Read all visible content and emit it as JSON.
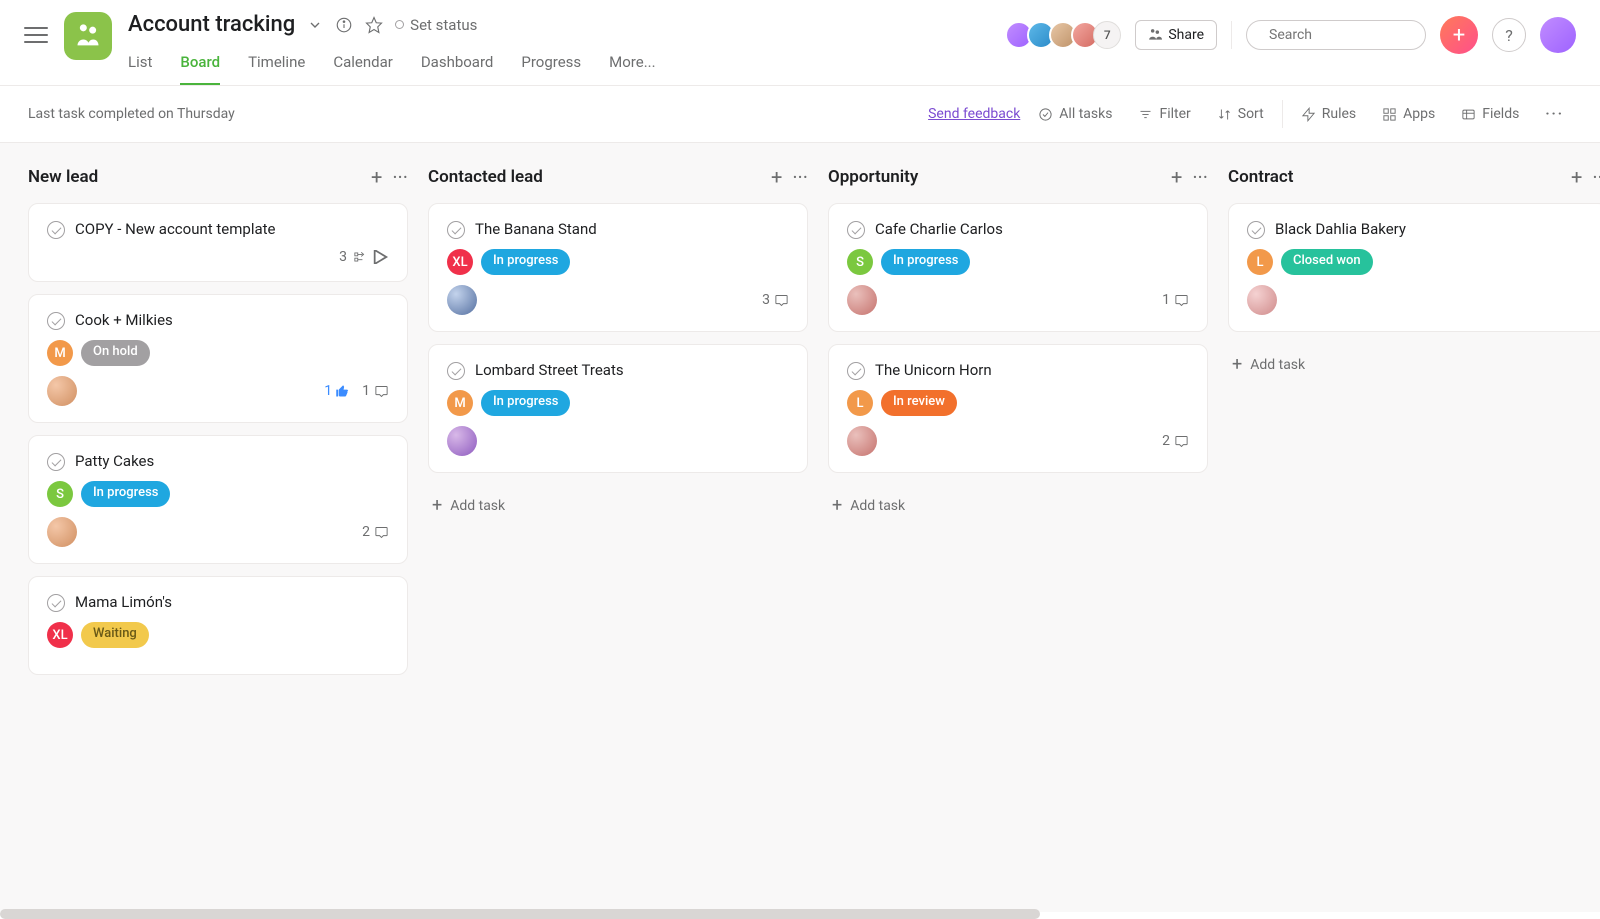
{
  "project": {
    "name": "Account tracking",
    "set_status": "Set status"
  },
  "tabs": {
    "list": "List",
    "board": "Board",
    "timeline": "Timeline",
    "calendar": "Calendar",
    "dashboard": "Dashboard",
    "progress": "Progress",
    "more": "More..."
  },
  "header": {
    "share": "Share",
    "search_placeholder": "Search",
    "help": "?",
    "overflow_count": "7"
  },
  "toolbar": {
    "last_task": "Last task completed on Thursday",
    "feedback": "Send feedback",
    "all_tasks": "All tasks",
    "filter": "Filter",
    "sort": "Sort",
    "rules": "Rules",
    "apps": "Apps",
    "fields": "Fields"
  },
  "add_task_label": "Add task",
  "columns": [
    {
      "title": "New lead",
      "cards": [
        {
          "title": "COPY - New account template",
          "pills": [],
          "assignee": null,
          "subtasks": "3",
          "likes": null,
          "comments": null
        },
        {
          "title": "Cook + Milkies",
          "pills": [
            {
              "text": "M",
              "short": true,
              "color": "c-orange"
            },
            {
              "text": "On hold",
              "color": "c-grey"
            }
          ],
          "assignee": "bg1",
          "likes": "1",
          "comments": "1"
        },
        {
          "title": "Patty Cakes",
          "pills": [
            {
              "text": "S",
              "short": true,
              "color": "c-green"
            },
            {
              "text": "In progress",
              "color": "c-blue"
            }
          ],
          "assignee": "bg1",
          "comments": "2"
        },
        {
          "title": "Mama Limón's",
          "pills": [
            {
              "text": "XL",
              "short": true,
              "color": "c-red"
            },
            {
              "text": "Waiting",
              "color": "c-yellow"
            }
          ],
          "assignee": null
        }
      ]
    },
    {
      "title": "Contacted lead",
      "cards": [
        {
          "title": "The Banana Stand",
          "pills": [
            {
              "text": "XL",
              "short": true,
              "color": "c-red"
            },
            {
              "text": "In progress",
              "color": "c-blue"
            }
          ],
          "assignee": "bg4",
          "comments": "3"
        },
        {
          "title": "Lombard Street Treats",
          "pills": [
            {
              "text": "M",
              "short": true,
              "color": "c-orange"
            },
            {
              "text": "In progress",
              "color": "c-blue"
            }
          ],
          "assignee": "bg2"
        }
      ]
    },
    {
      "title": "Opportunity",
      "cards": [
        {
          "title": "Cafe Charlie Carlos",
          "pills": [
            {
              "text": "S",
              "short": true,
              "color": "c-green"
            },
            {
              "text": "In progress",
              "color": "c-blue"
            }
          ],
          "assignee": "bg3",
          "comments": "1"
        },
        {
          "title": "The Unicorn Horn",
          "pills": [
            {
              "text": "L",
              "short": true,
              "color": "c-orange"
            },
            {
              "text": "In review",
              "color": "c-oran2"
            }
          ],
          "assignee": "bg3",
          "comments": "2"
        }
      ]
    },
    {
      "title": "Contract",
      "cards": [
        {
          "title": "Black Dahlia Bakery",
          "pills": [
            {
              "text": "L",
              "short": true,
              "color": "c-orange"
            },
            {
              "text": "Closed won",
              "color": "c-teal"
            }
          ],
          "assignee": "bg5"
        }
      ]
    }
  ]
}
